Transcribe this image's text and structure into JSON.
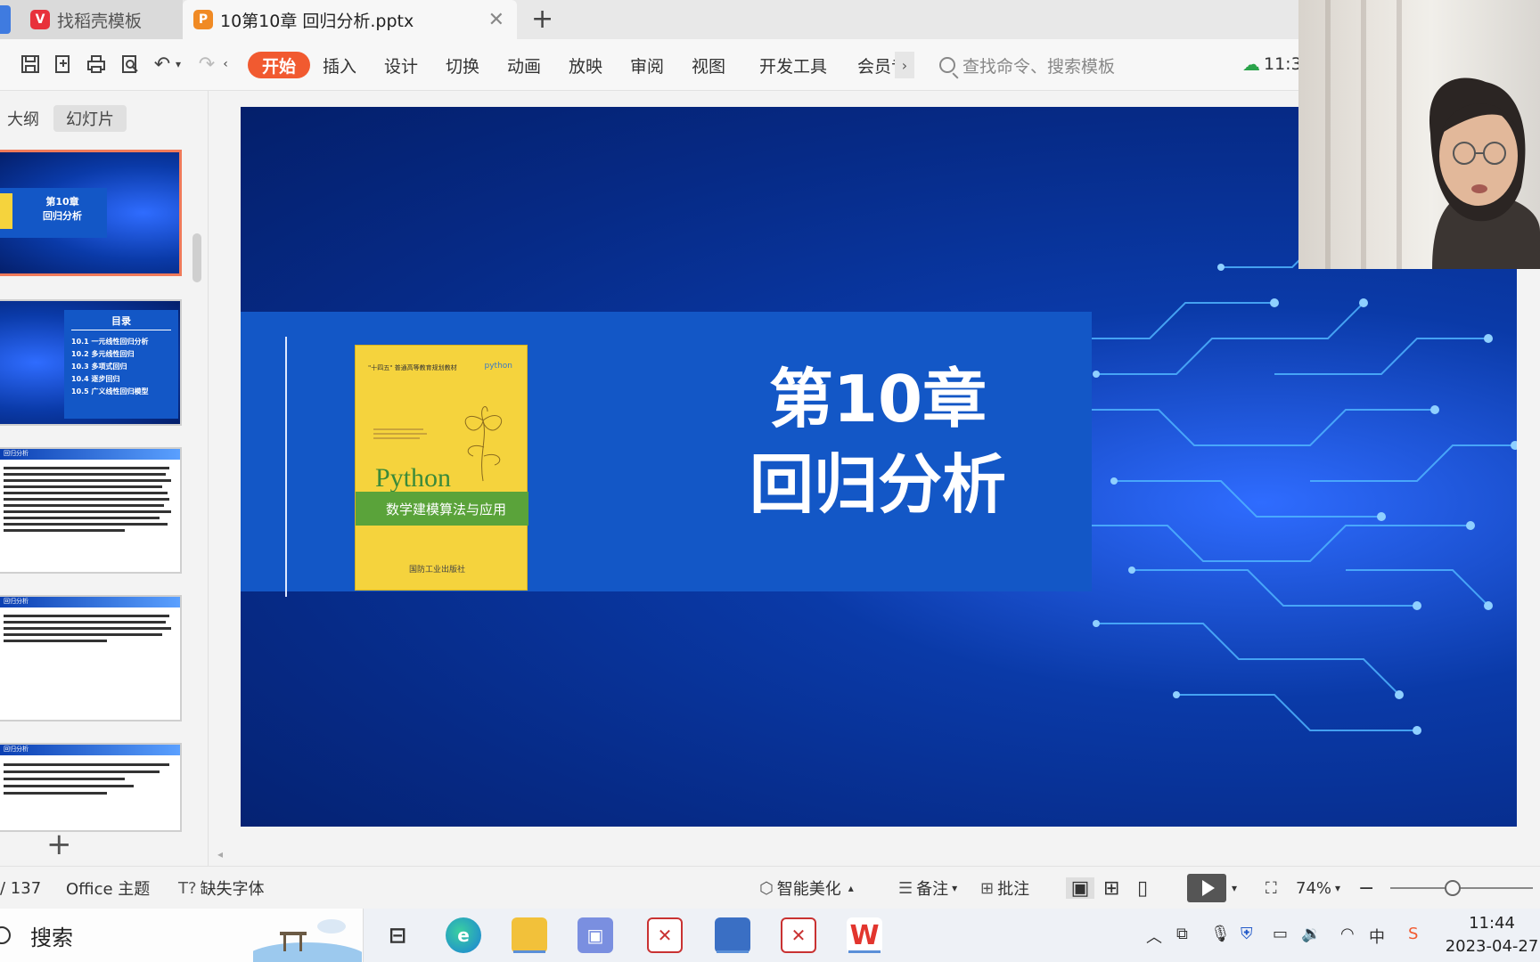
{
  "tabs": [
    {
      "label": "找稻壳模板",
      "icon": "wps-docer-icon"
    },
    {
      "label": "10第10章  回归分析.pptx",
      "icon": "wps-presentation-icon"
    }
  ],
  "toolbar": {
    "menus": [
      "开始",
      "插入",
      "设计",
      "切换",
      "动画",
      "放映",
      "审阅",
      "视图",
      "开发工具",
      "会员专"
    ],
    "active_menu": "开始",
    "search_placeholder": "查找命令、搜索模板",
    "cloud_time": "11:3"
  },
  "left_panel": {
    "tabs": [
      "大纲",
      "幻灯片"
    ],
    "selected_tab": "幻灯片",
    "thumbs": [
      {
        "title": "第10章",
        "subtitle": "回归分析"
      },
      {
        "title": "目录",
        "items": [
          "10.1 一元线性回归分析",
          "10.2 多元线性回归",
          "10.3 多项式回归",
          "10.4 逐步回归",
          "10.5 广义线性回归模型"
        ]
      },
      {
        "title": "回归分析"
      },
      {
        "title": "回归分析"
      },
      {
        "title": "回归分析"
      }
    ]
  },
  "slide": {
    "title_line1": "第10章",
    "title_line2": "回归分析",
    "book": {
      "series": "\"十四五\" 普通高等教育规划教材",
      "logo": "python",
      "big": "Python",
      "subtitle": "数学建模算法与应用",
      "publisher": "国防工业出版社"
    }
  },
  "status": {
    "page": "/ 137",
    "theme": "Office 主题",
    "missing_font": "缺失字体",
    "beautify": "智能美化",
    "notes": "备注",
    "comment": "批注",
    "zoom": "74%"
  },
  "taskbar": {
    "search": "搜索",
    "time": "11:44",
    "date": "2023-04-27"
  },
  "colors": {
    "accent": "#f15a30",
    "slide_bg": "#0a3aa8",
    "band": "#1357c6"
  }
}
